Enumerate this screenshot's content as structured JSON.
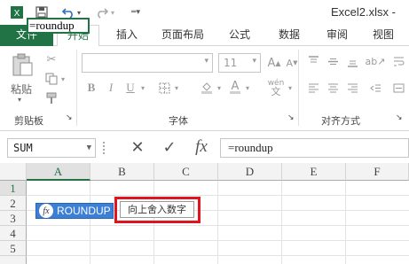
{
  "window": {
    "title": "Excel2.xlsx - "
  },
  "ribbon": {
    "tabs": [
      "文件",
      "开始",
      "插入",
      "页面布局",
      "公式",
      "数据",
      "审阅",
      "视图"
    ],
    "active_tab": "开始",
    "groups": {
      "clipboard": {
        "label": "剪贴板",
        "paste_label": "粘贴"
      },
      "font": {
        "label": "字体",
        "font_size": "11",
        "phonetic": "wén"
      },
      "alignment": {
        "label": "对齐方式"
      }
    }
  },
  "formula_bar": {
    "name_box": "SUM",
    "cancel_symbol": "✕",
    "enter_symbol": "✓",
    "fx_symbol": "fx",
    "content": "=roundup"
  },
  "grid": {
    "columns": [
      "A",
      "B",
      "C",
      "D",
      "E",
      "F"
    ],
    "selected_column": "A",
    "rows": [
      "1",
      "2",
      "3",
      "4",
      "5"
    ],
    "selected_row": "1",
    "active_cell_value": "=roundup"
  },
  "autocomplete": {
    "item_icon": "fx",
    "item_label": "ROUNDUP",
    "tooltip": "向上舍入数字"
  },
  "colors": {
    "excel_green": "#217346",
    "autocomplete_blue": "#3c7fd6",
    "highlight_red": "#e0141e"
  }
}
